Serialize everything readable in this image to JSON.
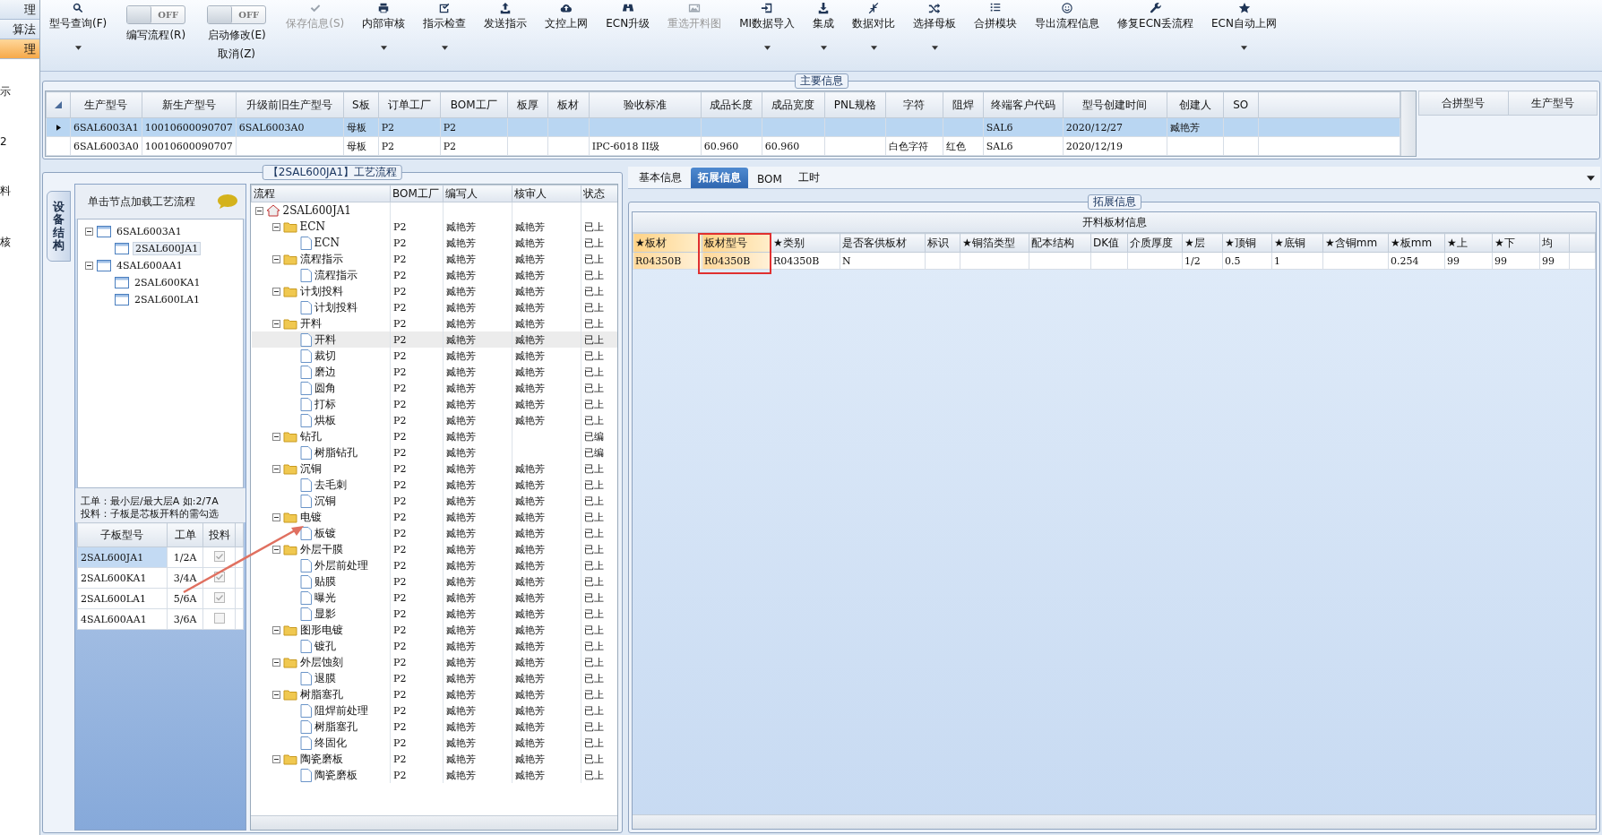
{
  "nav": {
    "items": [
      {
        "label": "理",
        "selected": false
      },
      {
        "label": "算法",
        "selected": false
      },
      {
        "label": "理",
        "selected": true
      }
    ],
    "labels": [
      "示",
      "2",
      "料",
      "核"
    ]
  },
  "toolbar": [
    {
      "kind": "button",
      "label": "型号查询(F)",
      "dropdown": true,
      "disabled": false
    },
    {
      "kind": "toggle",
      "toggle": "OFF",
      "on": false,
      "label": "编写流程(R)"
    },
    {
      "kind": "toggle",
      "toggle": "OFF",
      "on": false,
      "label": "启动修改(E)",
      "label2": "取消(Z)"
    },
    {
      "kind": "button",
      "label": "保存信息(S)",
      "dropdown": false,
      "disabled": true
    },
    {
      "kind": "button",
      "label": "内部审核",
      "dropdown": true,
      "disabled": false
    },
    {
      "kind": "button",
      "label": "指示检查",
      "dropdown": true,
      "disabled": false
    },
    {
      "kind": "button",
      "label": "发送指示",
      "dropdown": false,
      "disabled": false
    },
    {
      "kind": "button",
      "label": "文控上网",
      "dropdown": false,
      "disabled": false
    },
    {
      "kind": "button",
      "label": "ECN升级",
      "dropdown": false,
      "disabled": false
    },
    {
      "kind": "button",
      "label": "重选开料图",
      "dropdown": false,
      "disabled": true
    },
    {
      "kind": "button",
      "label": "MI数据导入",
      "dropdown": true,
      "disabled": false
    },
    {
      "kind": "button",
      "label": "集成",
      "dropdown": true,
      "disabled": false
    },
    {
      "kind": "button",
      "label": "数据对比",
      "dropdown": true,
      "disabled": false
    },
    {
      "kind": "button",
      "label": "选择母板",
      "dropdown": true,
      "disabled": false
    },
    {
      "kind": "button",
      "label": "合拼模块",
      "dropdown": false,
      "disabled": false
    },
    {
      "kind": "button",
      "label": "导出流程信息",
      "dropdown": false,
      "disabled": false
    },
    {
      "kind": "button",
      "label": "修复ECN丢流程",
      "dropdown": false,
      "disabled": false
    },
    {
      "kind": "button",
      "label": "ECN自动上网",
      "dropdown": true,
      "disabled": false
    }
  ],
  "main_info": {
    "title": "主要信息",
    "columns": [
      "生产型号",
      "新生产型号",
      "升级前旧生产型号",
      "S板",
      "订单工厂",
      "BOM工厂",
      "板厚",
      "板材",
      "验收标准",
      "成品长度",
      "成品宽度",
      "PNL规格",
      "字符",
      "阻焊",
      "终端客户代码",
      "型号创建时间",
      "创建人",
      "SO"
    ],
    "rows": [
      {
        "selected": true,
        "cells": [
          "6SAL6003A1",
          "10010600090707",
          "6SAL6003A0",
          "母板",
          "P2",
          "P2",
          null,
          null,
          null,
          null,
          null,
          null,
          null,
          null,
          "SAL6",
          "2020/12/27",
          "臧艳芳",
          null
        ]
      },
      {
        "selected": false,
        "cells": [
          "6SAL6003A0",
          "10010600090707",
          null,
          "母板",
          "P2",
          "P2",
          null,
          null,
          "IPC-6018 II级",
          "60.960",
          "60.960",
          null,
          "白色字符",
          "红色",
          "SAL6",
          "2020/12/19",
          null,
          null
        ]
      }
    ],
    "side_columns": [
      "合拼型号",
      "生产型号"
    ]
  },
  "process": {
    "title": "【2SAL600JA1】工艺流程",
    "vertical_tab": "设备结构",
    "hint": "单击节点加载工艺流程",
    "tree": [
      {
        "label": "6SAL6003A1",
        "expanded": true,
        "selected": false,
        "children": [
          {
            "label": "2SAL600JA1",
            "selected": true
          }
        ]
      },
      {
        "label": "4SAL600AA1",
        "expanded": true,
        "selected": false,
        "children": [
          {
            "label": "2SAL600KA1",
            "selected": false
          },
          {
            "label": "2SAL600LA1",
            "selected": false
          }
        ]
      }
    ],
    "note": [
      "工单：最小层/最大层A 如:2/7A",
      "投料：子板是芯板开料的需勾选"
    ],
    "sub_columns": [
      "子板型号",
      "工单",
      "投料"
    ],
    "sub_rows": [
      {
        "model": "2SAL600JA1",
        "order": "1/2A",
        "checked": true,
        "selected": true
      },
      {
        "model": "2SAL600KA1",
        "order": "3/4A",
        "checked": true,
        "selected": false
      },
      {
        "model": "2SAL600LA1",
        "order": "5/6A",
        "checked": true,
        "selected": false
      },
      {
        "model": "4SAL600AA1",
        "order": "3/6A",
        "checked": false,
        "selected": false
      }
    ],
    "flow_columns": [
      "流程",
      "BOM工厂",
      "编写人",
      "核审人",
      "状态"
    ],
    "flow": [
      {
        "kind": "root",
        "label": "2SAL600JA1",
        "expanded": true,
        "selected": false,
        "children": [
          {
            "kind": "folder",
            "label": "ECN",
            "expanded": true,
            "selected": false,
            "bom": "P2",
            "writer": "臧艳芳",
            "reviewer": "臧艳芳",
            "status": "已上",
            "children": [
              {
                "kind": "step",
                "label": "ECN",
                "selected": false,
                "bom": "P2",
                "writer": "臧艳芳",
                "reviewer": "臧艳芳",
                "status": "已上"
              }
            ]
          },
          {
            "kind": "folder",
            "label": "流程指示",
            "expanded": true,
            "selected": false,
            "bom": "P2",
            "writer": "臧艳芳",
            "reviewer": "臧艳芳",
            "status": "已上",
            "children": [
              {
                "kind": "step",
                "label": "流程指示",
                "selected": false,
                "bom": "P2",
                "writer": "臧艳芳",
                "reviewer": "臧艳芳",
                "status": "已上"
              }
            ]
          },
          {
            "kind": "folder",
            "label": "计划投料",
            "expanded": true,
            "selected": false,
            "bom": "P2",
            "writer": "臧艳芳",
            "reviewer": "臧艳芳",
            "status": "已上",
            "children": [
              {
                "kind": "step",
                "label": "计划投料",
                "selected": false,
                "bom": "P2",
                "writer": "臧艳芳",
                "reviewer": "臧艳芳",
                "status": "已上"
              }
            ]
          },
          {
            "kind": "folder",
            "label": "开料",
            "expanded": true,
            "selected": false,
            "bom": "P2",
            "writer": "臧艳芳",
            "reviewer": "臧艳芳",
            "status": "已上",
            "children": [
              {
                "kind": "step",
                "label": "开料",
                "selected": true,
                "bom": "P2",
                "writer": "臧艳芳",
                "reviewer": "臧艳芳",
                "status": "已上"
              },
              {
                "kind": "step",
                "label": "裁切",
                "selected": false,
                "bom": "P2",
                "writer": "臧艳芳",
                "reviewer": "臧艳芳",
                "status": "已上"
              },
              {
                "kind": "step",
                "label": "磨边",
                "selected": false,
                "bom": "P2",
                "writer": "臧艳芳",
                "reviewer": "臧艳芳",
                "status": "已上"
              },
              {
                "kind": "step",
                "label": "圆角",
                "selected": false,
                "bom": "P2",
                "writer": "臧艳芳",
                "reviewer": "臧艳芳",
                "status": "已上"
              },
              {
                "kind": "step",
                "label": "打标",
                "selected": false,
                "bom": "P2",
                "writer": "臧艳芳",
                "reviewer": "臧艳芳",
                "status": "已上"
              },
              {
                "kind": "step",
                "label": "烘板",
                "selected": false,
                "bom": "P2",
                "writer": "臧艳芳",
                "reviewer": "臧艳芳",
                "status": "已上"
              }
            ]
          },
          {
            "kind": "folder",
            "label": "钻孔",
            "expanded": true,
            "selected": false,
            "bom": "P2",
            "writer": "臧艳芳",
            "status": "已编",
            "children": [
              {
                "kind": "step",
                "label": "树脂钻孔",
                "selected": false,
                "bom": "P2",
                "writer": "臧艳芳",
                "status": "已编"
              }
            ]
          },
          {
            "kind": "folder",
            "label": "沉铜",
            "expanded": true,
            "selected": false,
            "bom": "P2",
            "writer": "臧艳芳",
            "reviewer": "臧艳芳",
            "status": "已上",
            "children": [
              {
                "kind": "step",
                "label": "去毛刺",
                "selected": false,
                "bom": "P2",
                "writer": "臧艳芳",
                "reviewer": "臧艳芳",
                "status": "已上"
              },
              {
                "kind": "step",
                "label": "沉铜",
                "selected": false,
                "bom": "P2",
                "writer": "臧艳芳",
                "reviewer": "臧艳芳",
                "status": "已上"
              }
            ]
          },
          {
            "kind": "folder",
            "label": "电镀",
            "expanded": true,
            "selected": false,
            "bom": "P2",
            "writer": "臧艳芳",
            "reviewer": "臧艳芳",
            "status": "已上",
            "children": [
              {
                "kind": "step",
                "label": "板镀",
                "selected": false,
                "bom": "P2",
                "writer": "臧艳芳",
                "reviewer": "臧艳芳",
                "status": "已上"
              }
            ]
          },
          {
            "kind": "folder",
            "label": "外层干膜",
            "expanded": true,
            "selected": false,
            "bom": "P2",
            "writer": "臧艳芳",
            "reviewer": "臧艳芳",
            "status": "已上",
            "children": [
              {
                "kind": "step",
                "label": "外层前处理",
                "selected": false,
                "bom": "P2",
                "writer": "臧艳芳",
                "reviewer": "臧艳芳",
                "status": "已上"
              },
              {
                "kind": "step",
                "label": "贴膜",
                "selected": false,
                "bom": "P2",
                "writer": "臧艳芳",
                "reviewer": "臧艳芳",
                "status": "已上"
              },
              {
                "kind": "step",
                "label": "曝光",
                "selected": false,
                "bom": "P2",
                "writer": "臧艳芳",
                "reviewer": "臧艳芳",
                "status": "已上"
              },
              {
                "kind": "step",
                "label": "显影",
                "selected": false,
                "bom": "P2",
                "writer": "臧艳芳",
                "reviewer": "臧艳芳",
                "status": "已上"
              }
            ]
          },
          {
            "kind": "folder",
            "label": "图形电镀",
            "expanded": true,
            "selected": false,
            "bom": "P2",
            "writer": "臧艳芳",
            "reviewer": "臧艳芳",
            "status": "已上",
            "children": [
              {
                "kind": "step",
                "label": "镀孔",
                "selected": false,
                "bom": "P2",
                "writer": "臧艳芳",
                "reviewer": "臧艳芳",
                "status": "已上"
              }
            ]
          },
          {
            "kind": "folder",
            "label": "外层蚀刻",
            "expanded": true,
            "selected": false,
            "bom": "P2",
            "writer": "臧艳芳",
            "reviewer": "臧艳芳",
            "status": "已上",
            "children": [
              {
                "kind": "step",
                "label": "退膜",
                "selected": false,
                "bom": "P2",
                "writer": "臧艳芳",
                "reviewer": "臧艳芳",
                "status": "已上"
              }
            ]
          },
          {
            "kind": "folder",
            "label": "树脂塞孔",
            "expanded": true,
            "selected": false,
            "bom": "P2",
            "writer": "臧艳芳",
            "reviewer": "臧艳芳",
            "status": "已上",
            "children": [
              {
                "kind": "step",
                "label": "阻焊前处理",
                "selected": false,
                "bom": "P2",
                "writer": "臧艳芳",
                "reviewer": "臧艳芳",
                "status": "已上"
              },
              {
                "kind": "step",
                "label": "树脂塞孔",
                "selected": false,
                "bom": "P2",
                "writer": "臧艳芳",
                "reviewer": "臧艳芳",
                "status": "已上"
              },
              {
                "kind": "step",
                "label": "终固化",
                "selected": false,
                "bom": "P2",
                "writer": "臧艳芳",
                "reviewer": "臧艳芳",
                "status": "已上"
              }
            ]
          },
          {
            "kind": "folder",
            "label": "陶瓷磨板",
            "expanded": true,
            "selected": false,
            "bom": "P2",
            "writer": "臧艳芳",
            "reviewer": "臧艳芳",
            "status": "已上",
            "children": [
              {
                "kind": "step",
                "label": "陶瓷磨板",
                "selected": false,
                "bom": "P2",
                "writer": "臧艳芳",
                "reviewer": "臧艳芳",
                "status": "已上"
              }
            ]
          }
        ]
      }
    ]
  },
  "detail": {
    "tabs": [
      {
        "label": "基本信息",
        "selected": false
      },
      {
        "label": "拓展信息",
        "selected": true
      },
      {
        "label": "BOM",
        "selected": false
      },
      {
        "label": "工时",
        "selected": false
      }
    ],
    "group_title": "拓展信息",
    "table_title": "开料板材信息",
    "columns": [
      {
        "label": "★板材",
        "highlight": true
      },
      {
        "label": "板材型号",
        "highlight": true
      },
      {
        "label": "★类别",
        "highlight": false
      },
      {
        "label": "是否客供板材",
        "highlight": false
      },
      {
        "label": "标识",
        "highlight": false
      },
      {
        "label": "★铜箔类型",
        "highlight": false
      },
      {
        "label": "配本结构",
        "highlight": false
      },
      {
        "label": "DK值",
        "highlight": false
      },
      {
        "label": "介质厚度",
        "highlight": false
      },
      {
        "label": "★层",
        "highlight": false
      },
      {
        "label": "★顶铜",
        "highlight": false
      },
      {
        "label": "★底铜",
        "highlight": false
      },
      {
        "label": "★含铜mm",
        "highlight": false
      },
      {
        "label": "★板mm",
        "highlight": false
      },
      {
        "label": "★上",
        "highlight": false
      },
      {
        "label": "★下",
        "highlight": false
      },
      {
        "label": "均",
        "highlight": false
      }
    ],
    "rows": [
      [
        "R04350B",
        "R04350B",
        "R04350B",
        "N",
        null,
        null,
        null,
        null,
        null,
        "1/2",
        "0.5",
        "1",
        null,
        "0.254",
        "99",
        "99",
        "99"
      ]
    ]
  }
}
